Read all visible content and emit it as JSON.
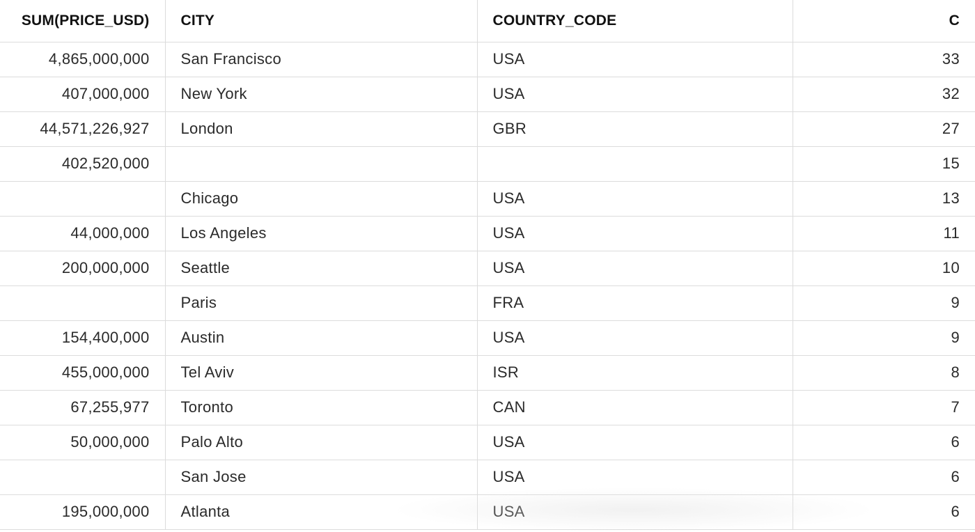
{
  "table": {
    "columns": [
      "SUM(PRICE_USD)",
      "CITY",
      "COUNTRY_CODE",
      "C"
    ],
    "rows": [
      [
        "4,865,000,000",
        "San Francisco",
        "USA",
        "33"
      ],
      [
        "407,000,000",
        "New York",
        "USA",
        "32"
      ],
      [
        "44,571,226,927",
        "London",
        "GBR",
        "27"
      ],
      [
        "402,520,000",
        "",
        "",
        "15"
      ],
      [
        "",
        "Chicago",
        "USA",
        "13"
      ],
      [
        "44,000,000",
        "Los Angeles",
        "USA",
        "11"
      ],
      [
        "200,000,000",
        "Seattle",
        "USA",
        "10"
      ],
      [
        "",
        "Paris",
        "FRA",
        "9"
      ],
      [
        "154,400,000",
        "Austin",
        "USA",
        "9"
      ],
      [
        "455,000,000",
        "Tel Aviv",
        "ISR",
        "8"
      ],
      [
        "67,255,977",
        "Toronto",
        "CAN",
        "7"
      ],
      [
        "50,000,000",
        "Palo Alto",
        "USA",
        "6"
      ],
      [
        "",
        "San Jose",
        "USA",
        "6"
      ],
      [
        "195,000,000",
        "Atlanta",
        "USA",
        "6"
      ]
    ]
  }
}
